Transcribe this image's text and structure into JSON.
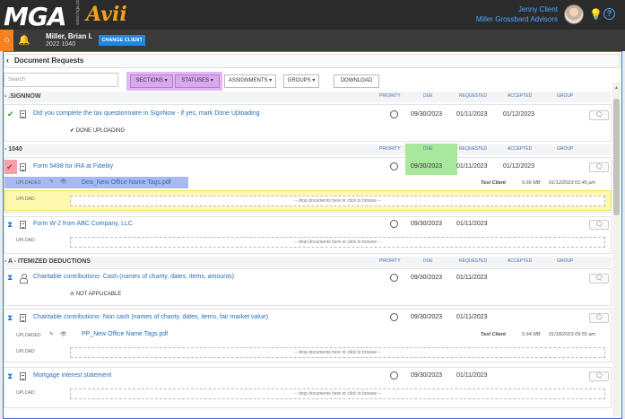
{
  "header": {
    "logo_main": "MGA",
    "logo_sub": "www.mga.pc",
    "logo_product": "Avii",
    "user_name": "Jenny Client",
    "user_firm": "Miller Grossbard Advisors"
  },
  "client_bar": {
    "client_name": "Miller, Brian I.",
    "client_year": "2022 1040",
    "change_client_label": "CHANGE CLIENT"
  },
  "page": {
    "title": "Document Requests",
    "search_placeholder": "Search",
    "buttons": {
      "sections": "SECTIONS ▾",
      "statuses": "STATUSES ▾",
      "assignments": "ASSIGNMENTS ▾",
      "groups": "GROUPS ▾",
      "download": "DOWNLOAD"
    }
  },
  "columns": {
    "priority": "PRIORITY",
    "due": "DUE",
    "requested": "REQUESTED",
    "accepted": "ACCEPTED",
    "group": "GROUP"
  },
  "sections": [
    {
      "title": "- .SIGNNOW",
      "items": [
        {
          "text": "Did you complete the tax questionnaire in SignNow - if yes, mark Done Uploading",
          "due": "09/30/2023",
          "requested": "01/11/2023",
          "accepted": "01/12/2023",
          "status_text": "✔ DONE UPLOADING"
        }
      ]
    },
    {
      "title": "- 1040",
      "items": [
        {
          "text": "Form 5498 for IRA at Fidelity",
          "due": "09/30/2023",
          "requested": "01/11/2023",
          "accepted": "01/12/2023",
          "uploaded_label": "UPLOADED",
          "file_name": "Dea_New Office Name Tags.pdf",
          "uploader": "Test Client",
          "file_size": "5.66 MB",
          "file_date": "01/12/2023 01:45 pm",
          "upload_label": "UPLOAD",
          "drop_text": "-- drop documents here or click to browse --"
        },
        {
          "text": "Form W-2 from ABC Company, LLC",
          "due": "09/30/2023",
          "requested": "01/11/2023",
          "upload_label": "UPLOAD",
          "drop_text": "-- drop documents here or click to browse --"
        }
      ]
    },
    {
      "title": "- A - ITEMIZED DEDUCTIONS",
      "items": [
        {
          "text": "Charitable contributions- Cash (names of charity, dates, items, amounts)",
          "due": "09/30/2023",
          "requested": "01/11/2023",
          "status_text": "⊘ NOT APPLICABLE"
        },
        {
          "text": "Charitable contributions- Non cash (names of charity, dates, items, fair market value)",
          "due": "09/30/2023",
          "requested": "01/11/2023",
          "uploaded_label": "UPLOADED",
          "file_name": "PP_New Office Name Tags.pdf",
          "uploader": "Test Client",
          "file_size": "5.64 MB",
          "file_date": "01/18/2023 09:55 am",
          "upload_label": "UPLOAD",
          "drop_text": "-- drop documents here or click to browse --"
        },
        {
          "text": "Mortgage interest statement",
          "due": "09/30/2023",
          "requested": "01/11/2023",
          "upload_label": "UPLOAD",
          "drop_text": "-- drop documents here or click to browse --"
        }
      ]
    }
  ],
  "colors": {
    "accent_blue": "#2a6fb5",
    "brand_orange": "#f5a21b",
    "highlight_purple": "#e3b7f4",
    "highlight_green": "#a8e89d",
    "highlight_red": "#f4a0a8",
    "highlight_blue": "#a8b8f0",
    "highlight_yellow": "#fff9b0"
  },
  "icons": {
    "home": "home-icon",
    "bell": "bell-icon",
    "bulb": "lightbulb-icon",
    "help": "help-icon",
    "comment": "comment-icon",
    "edit": "edit-icon",
    "view": "eye-icon",
    "check": "check-icon",
    "hourglass": "hourglass-icon",
    "document": "document-icon",
    "person": "person-icon"
  }
}
